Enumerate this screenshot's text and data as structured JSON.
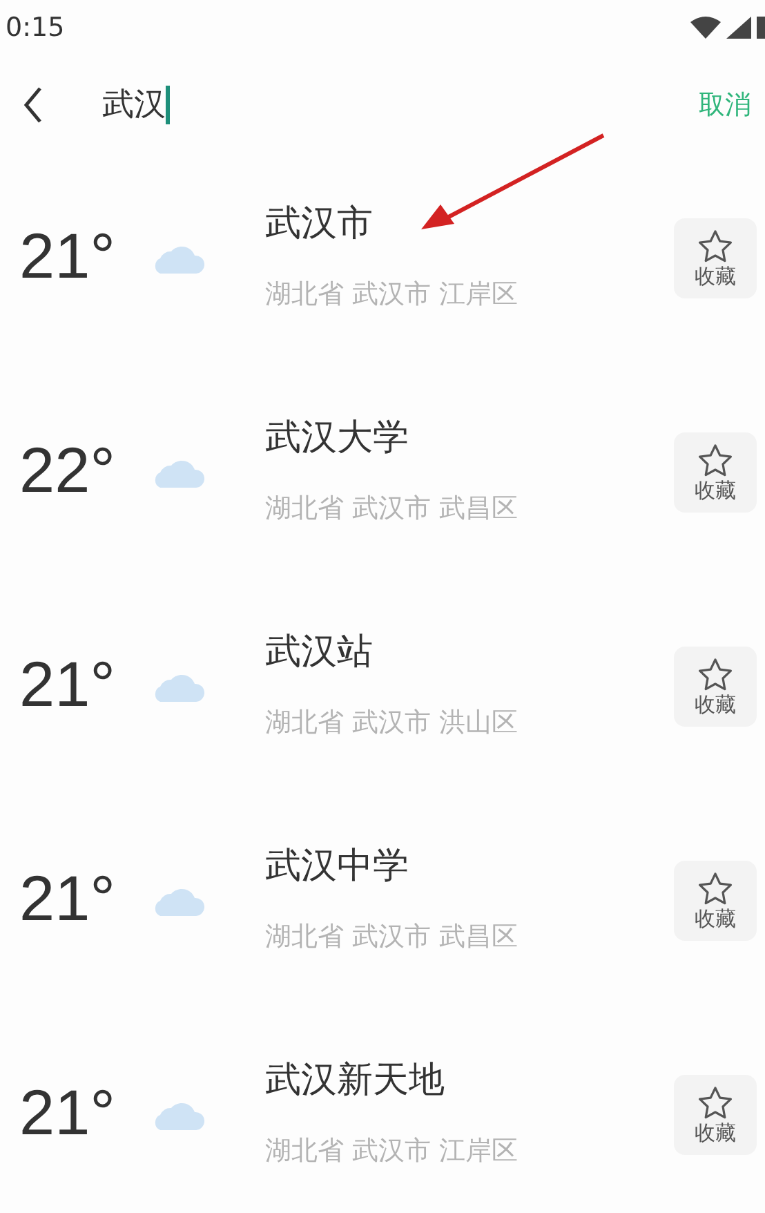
{
  "status_bar": {
    "time": "0:15"
  },
  "search": {
    "value": "武汉",
    "cancel": "取消"
  },
  "results": [
    {
      "temperature": "21°",
      "name": "武汉市",
      "address": "湖北省 武汉市 江岸区",
      "favorite_label": "收藏"
    },
    {
      "temperature": "22°",
      "name": "武汉大学",
      "address": "湖北省 武汉市 武昌区",
      "favorite_label": "收藏"
    },
    {
      "temperature": "21°",
      "name": "武汉站",
      "address": "湖北省 武汉市 洪山区",
      "favorite_label": "收藏"
    },
    {
      "temperature": "21°",
      "name": "武汉中学",
      "address": "湖北省 武汉市 武昌区",
      "favorite_label": "收藏"
    },
    {
      "temperature": "21°",
      "name": "武汉新天地",
      "address": "湖北省 武汉市 江岸区",
      "favorite_label": "收藏"
    }
  ]
}
